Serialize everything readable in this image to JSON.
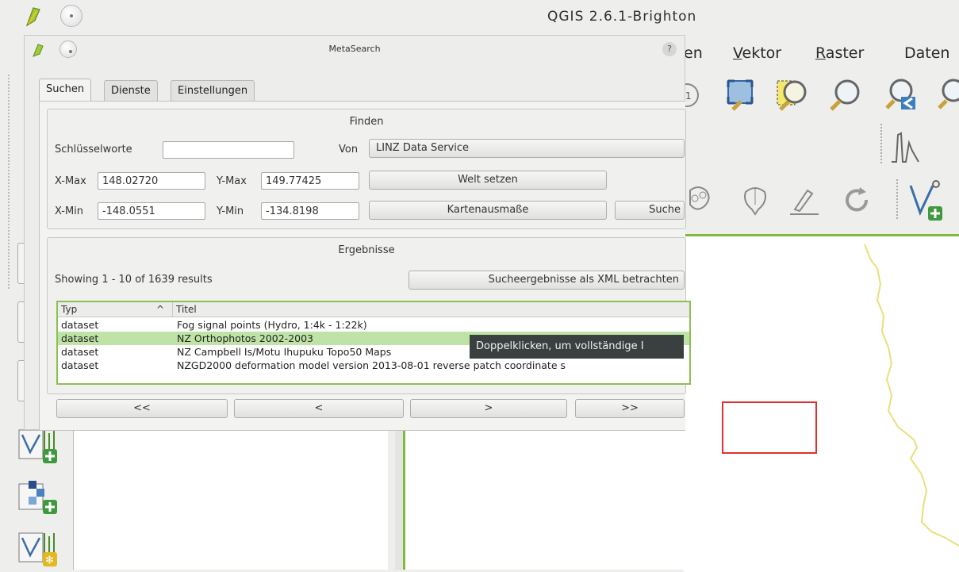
{
  "app": {
    "title": "QGIS 2.6.1-Brighton",
    "menu": [
      {
        "label": "en"
      },
      {
        "label": "Vektor",
        "accel": "V",
        "rest": "ektor"
      },
      {
        "label": "Raster",
        "accel": "R",
        "rest": "aster"
      },
      {
        "label": "Daten",
        "accel": "",
        "rest": "Daten"
      }
    ]
  },
  "dialog": {
    "title": "MetaSearch",
    "help_icon": "?",
    "tabs": [
      {
        "label": "Suchen"
      },
      {
        "label": "Dienste"
      },
      {
        "label": "Einstellungen"
      }
    ],
    "find": {
      "group_title": "Finden",
      "keywords_label": "Schlüsselworte",
      "keywords_value": "",
      "from_label": "Von",
      "from_value": "LINZ Data Service",
      "xmax_label": "X-Max",
      "xmax_value": "148.02720",
      "ymax_label": "Y-Max",
      "ymax_value": "149.77425",
      "xmin_label": "X-Min",
      "xmin_value": "-148.0551",
      "ymin_label": "Y-Min",
      "ymin_value": "-134.8198",
      "world_button": "Welt setzen",
      "extent_button": "Kartenausmaße",
      "search_button": "Suche"
    },
    "results": {
      "group_title": "Ergebnisse",
      "summary": "Showing 1 - 10 of 1639 results",
      "xml_button": "Sucheergebnisse als XML betrachten",
      "columns": [
        "Typ",
        "Titel"
      ],
      "sort_indicator": "^",
      "rows": [
        {
          "type": "dataset",
          "title": "Fog signal points (Hydro, 1:4k - 1:22k)"
        },
        {
          "type": "dataset",
          "title": "NZ Orthophotos 2002-2003"
        },
        {
          "type": "dataset",
          "title": "NZ Campbell Is/Motu Ihupuku Topo50 Maps"
        },
        {
          "type": "dataset",
          "title": "NZGD2000 deformation model version 2013-08-01 reverse patch coordinate s"
        }
      ],
      "tooltip": "Doppelklicken, um vollständige I"
    },
    "nav": {
      "first": "<<",
      "prev": "<",
      "next": ">",
      "last": ">>"
    }
  },
  "colors": {
    "accent_green": "#7fba3e",
    "selection_green": "#bfe3a6",
    "extent_red": "#e03030",
    "coastline_yellow": "#e8e07a"
  },
  "icons": {
    "app": "qgis-logo-icon",
    "toolbar": [
      "zoom-native-icon",
      "zoom-full-icon",
      "zoom-selection-icon",
      "zoom-layer-icon",
      "zoom-last-icon",
      "zoom-next-icon",
      "histogram-icon",
      "identify-icon",
      "pan-icon",
      "measure-icon",
      "refresh-icon",
      "add-vector-layer-icon"
    ],
    "dock": [
      "add-vector-icon",
      "add-raster-icon",
      "new-shapefile-icon"
    ]
  }
}
